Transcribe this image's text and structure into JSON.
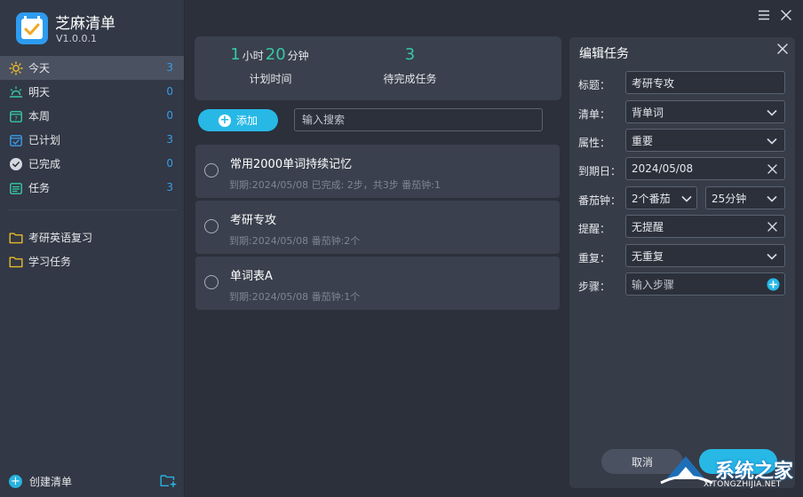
{
  "app": {
    "name": "芝麻清单",
    "version": "V1.0.0.1"
  },
  "colors": {
    "accent": "#27b8e6",
    "green": "#35c9a5",
    "count": "#3a9ce8",
    "folder": "#e9b92b"
  },
  "sidebar": {
    "nav": [
      {
        "label": "今天",
        "count": "3",
        "icon": "sun-icon"
      },
      {
        "label": "明天",
        "count": "0",
        "icon": "sunrise-icon"
      },
      {
        "label": "本周",
        "count": "0",
        "icon": "calendar-week-icon"
      },
      {
        "label": "已计划",
        "count": "3",
        "icon": "calendar-check-icon"
      },
      {
        "label": "已完成",
        "count": "0",
        "icon": "check-circle-icon"
      },
      {
        "label": "任务",
        "count": "3",
        "icon": "task-list-icon"
      }
    ],
    "lists": [
      {
        "label": "考研英语复习",
        "icon": "folder-icon"
      },
      {
        "label": "学习任务",
        "icon": "folder-icon"
      }
    ],
    "create_label": "创建清单"
  },
  "stats": {
    "hours": "1",
    "hours_unit": "小时",
    "minutes": "20",
    "minutes_unit": "分钟",
    "plan_label": "计划时间",
    "pending": "3",
    "pending_label": "待完成任务"
  },
  "toolbar": {
    "add_label": "添加",
    "search_placeholder": "输入搜索"
  },
  "tasks": [
    {
      "title": "常用2000单词持续记忆",
      "meta": "到期:2024/05/08 已完成: 2步，共3步 番茄钟:1"
    },
    {
      "title": "考研专攻",
      "meta": "到期:2024/05/08 番茄钟:2个"
    },
    {
      "title": "单词表A",
      "meta": "到期:2024/05/08 番茄钟:1个"
    }
  ],
  "edit": {
    "header": "编辑任务",
    "title_label": "标题：",
    "title_value": "考研专攻",
    "list_label": "清单：",
    "list_value": "背单词",
    "attr_label": "属性：",
    "attr_value": "重要",
    "due_label": "到期日：",
    "due_value": "2024/05/08",
    "pomo_label": "番茄钟：",
    "pomo_count": "2个番茄",
    "pomo_len": "25分钟",
    "remind_label": "提醒：",
    "remind_value": "无提醒",
    "repeat_label": "重复：",
    "repeat_value": "无重复",
    "steps_label": "步骤：",
    "steps_placeholder": "输入步骤",
    "cancel_label": "取消",
    "ok_label": ""
  },
  "watermark": {
    "text": "系统之家",
    "sub": "XITONGZHIJIA.NET"
  }
}
